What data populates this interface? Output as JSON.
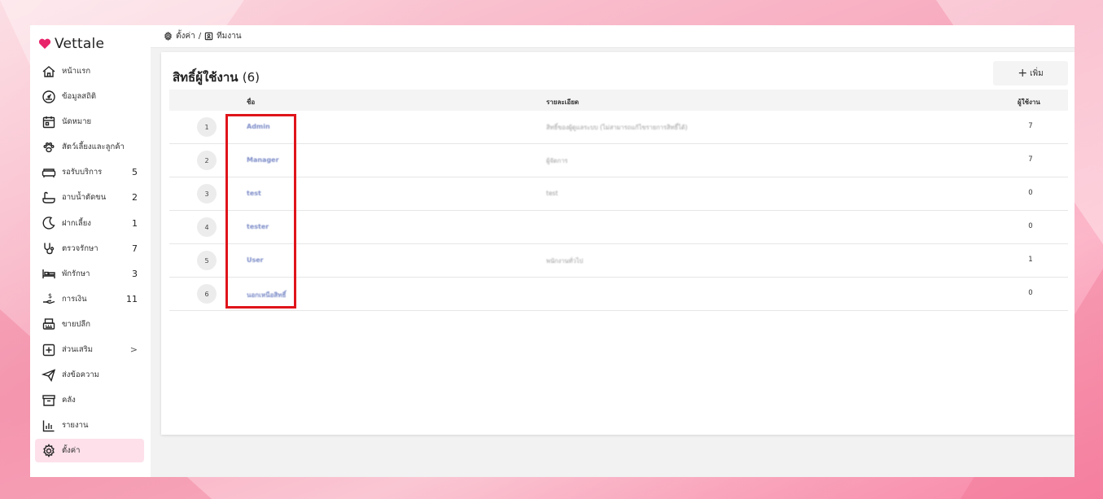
{
  "brand": {
    "name": "Vettale",
    "accent": "#e8246a"
  },
  "sidebar": {
    "items": [
      {
        "label": "หน้าแรก",
        "icon": "home-icon",
        "count": ""
      },
      {
        "label": "ข้อมูลสถิติ",
        "icon": "gauge-icon",
        "count": ""
      },
      {
        "label": "นัดหมาย",
        "icon": "calendar-icon",
        "count": ""
      },
      {
        "label": "สัตว์เลี้ยงและลูกค้า",
        "icon": "paw-icon",
        "count": ""
      },
      {
        "label": "รอรับบริการ",
        "icon": "sofa-icon",
        "count": "5"
      },
      {
        "label": "อาบน้ำตัดขน",
        "icon": "bathtub-icon",
        "count": "2"
      },
      {
        "label": "ฝากเลี้ยง",
        "icon": "moon-icon",
        "count": "1"
      },
      {
        "label": "ตรวจรักษา",
        "icon": "stethoscope-icon",
        "count": "7"
      },
      {
        "label": "พักรักษา",
        "icon": "bed-icon",
        "count": "3"
      },
      {
        "label": "การเงิน",
        "icon": "money-hand-icon",
        "count": "11"
      },
      {
        "label": "ขายปลีก",
        "icon": "cash-register-icon",
        "count": ""
      },
      {
        "label": "ส่วนเสริม",
        "icon": "plus-square-icon",
        "count": "",
        "arrow": ">"
      },
      {
        "label": "ส่งข้อความ",
        "icon": "paper-plane-icon",
        "count": ""
      },
      {
        "label": "คลัง",
        "icon": "archive-icon",
        "count": ""
      },
      {
        "label": "รายงาน",
        "icon": "bar-chart-icon",
        "count": ""
      },
      {
        "label": "ตั้งค่า",
        "icon": "gear-icon",
        "count": "",
        "active": true
      }
    ]
  },
  "breadcrumb": {
    "settings": "ตั้งค่า",
    "separator": "/",
    "team": "ทีมงาน"
  },
  "card": {
    "title": "สิทธิ์ผู้ใช้งาน",
    "count": "(6)",
    "add_label": "เพิ่ม",
    "columns": {
      "name": "ชื่อ",
      "detail": "รายละเอียด",
      "users": "ผู้ใช้งาน"
    },
    "rows": [
      {
        "num": "1",
        "name": "Admin",
        "detail": "สิทธิ์ของผู้ดูแลระบบ (ไม่สามารถแก้ไขรายการสิทธิ์ได้)",
        "users": "7"
      },
      {
        "num": "2",
        "name": "Manager",
        "detail": "ผู้จัดการ",
        "users": "7"
      },
      {
        "num": "3",
        "name": "test",
        "detail": "test",
        "users": "0"
      },
      {
        "num": "4",
        "name": "tester",
        "detail": "",
        "users": "0"
      },
      {
        "num": "5",
        "name": "User",
        "detail": "พนักงานทั่วไป",
        "users": "1"
      },
      {
        "num": "6",
        "name": "นอกเหนือสิทธิ์",
        "detail": "",
        "users": "0"
      }
    ]
  },
  "highlight_color": "#e0141b"
}
